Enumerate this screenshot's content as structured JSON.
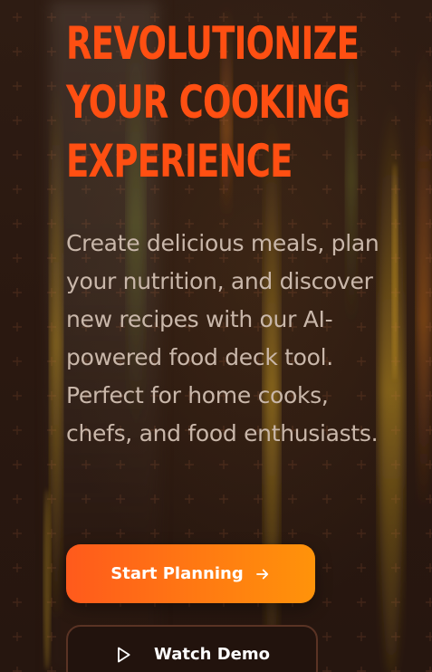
{
  "hero": {
    "title": "REVOLUTIONIZE\nYOUR COOKING\nEXPERIENCE",
    "description": "Create delicious meals, plan your nutrition, and discover new recipes with our AI-powered food deck tool. Perfect for home cooks, chefs, and food enthusiasts."
  },
  "actions": {
    "primary_label": "Start Planning",
    "primary_icon": "arrow-right-icon",
    "secondary_label": "Watch Demo",
    "secondary_icon": "play-icon"
  },
  "colors": {
    "background": "#2b1a12",
    "accent": "#ff4f12",
    "button_gradient_start": "#ff5a1c",
    "button_gradient_end": "#ff930a",
    "text_muted": "#c9b7aa",
    "secondary_button_border": "#5a3324"
  }
}
